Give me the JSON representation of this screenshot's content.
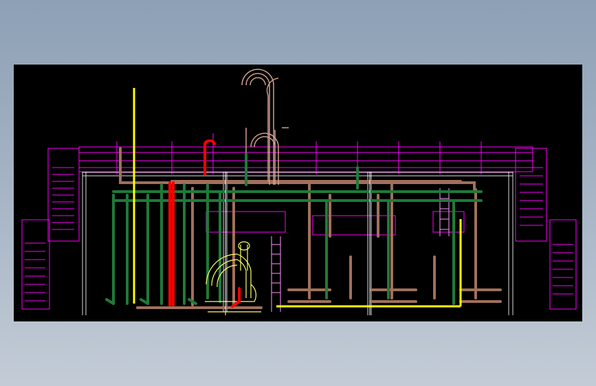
{
  "colors": {
    "background_top": "#8da0b5",
    "background_bottom": "#c3ccd6",
    "canvas": "#000000",
    "structure": "#ff00ff",
    "pipe_green": "#1f7a3a",
    "pipe_brown": "#a0705a",
    "pipe_yellow": "#ffff00",
    "pipe_red": "#ff0000",
    "pipe_white": "#ffffff",
    "outline_light": "#cfa090"
  },
  "icons": [
    "cad-drawing-viewport"
  ]
}
